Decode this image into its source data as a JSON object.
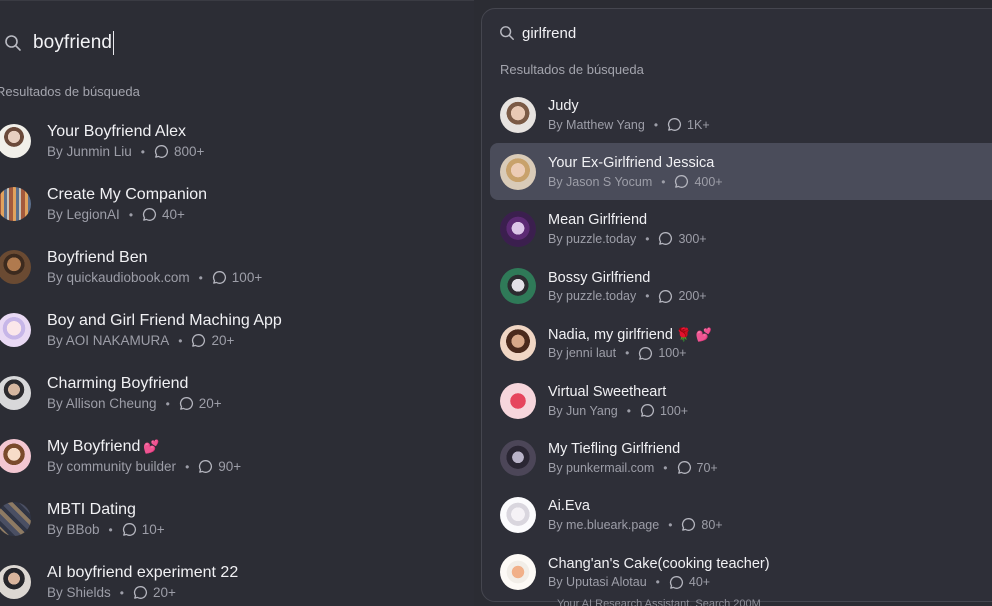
{
  "left": {
    "search_value": "boyfriend",
    "section_label": "Resultados de búsqueda",
    "items": [
      {
        "title": "Your Boyfriend Alex",
        "author": "By Junmin Liu",
        "count": "800+",
        "emoji": ""
      },
      {
        "title": "Create My Companion",
        "author": "By LegionAI",
        "count": "40+",
        "emoji": ""
      },
      {
        "title": "Boyfriend Ben",
        "author": "By quickaudiobook.com",
        "count": "100+",
        "emoji": ""
      },
      {
        "title": "Boy and Girl Friend Maching App",
        "author": "By AOI NAKAMURA",
        "count": "20+",
        "emoji": ""
      },
      {
        "title": "Charming Boyfriend",
        "author": "By Allison Cheung",
        "count": "20+",
        "emoji": ""
      },
      {
        "title": "My Boyfriend",
        "author": "By community builder",
        "count": "90+",
        "emoji": "💕"
      },
      {
        "title": "MBTI Dating",
        "author": "By BBob",
        "count": "10+",
        "emoji": ""
      },
      {
        "title": "AI boyfriend experiment 22",
        "author": "By Shields",
        "count": "20+",
        "emoji": ""
      }
    ]
  },
  "right": {
    "search_value": "girlfrend",
    "section_label": "Resultados de búsqueda",
    "items": [
      {
        "title": "Judy",
        "author": "By Matthew Yang",
        "count": "1K+",
        "emoji": ""
      },
      {
        "title": "Your Ex-Girlfriend Jessica",
        "author": "By Jason S Yocum",
        "count": "400+",
        "emoji": ""
      },
      {
        "title": "Mean Girlfriend",
        "author": "By puzzle.today",
        "count": "300+",
        "emoji": ""
      },
      {
        "title": "Bossy Girlfriend",
        "author": "By puzzle.today",
        "count": "200+",
        "emoji": ""
      },
      {
        "title": "Nadia, my girlfriend",
        "author": "By jenni laut",
        "count": "100+",
        "emoji": "🌹 💕"
      },
      {
        "title": "Virtual Sweetheart",
        "author": "By Jun Yang",
        "count": "100+",
        "emoji": ""
      },
      {
        "title": "My Tiefling Girlfriend",
        "author": "By punkermail.com",
        "count": "70+",
        "emoji": ""
      },
      {
        "title": "Ai.Eva",
        "author": "By me.blueark.page",
        "count": "80+",
        "emoji": ""
      },
      {
        "title": "Chang'an's Cake(cooking teacher)",
        "author": "By Uputasi Alotau",
        "count": "40+",
        "emoji": ""
      }
    ],
    "selected_index": 1
  },
  "bottom_peek": "Your AI Research Assistant. Search 200M",
  "colors": {
    "background": "#2b2c33",
    "panel": "#2e2f38",
    "selected_row": "#4a4c5a",
    "text_primary": "#f1f1f4",
    "text_secondary": "#9d9ea8"
  }
}
